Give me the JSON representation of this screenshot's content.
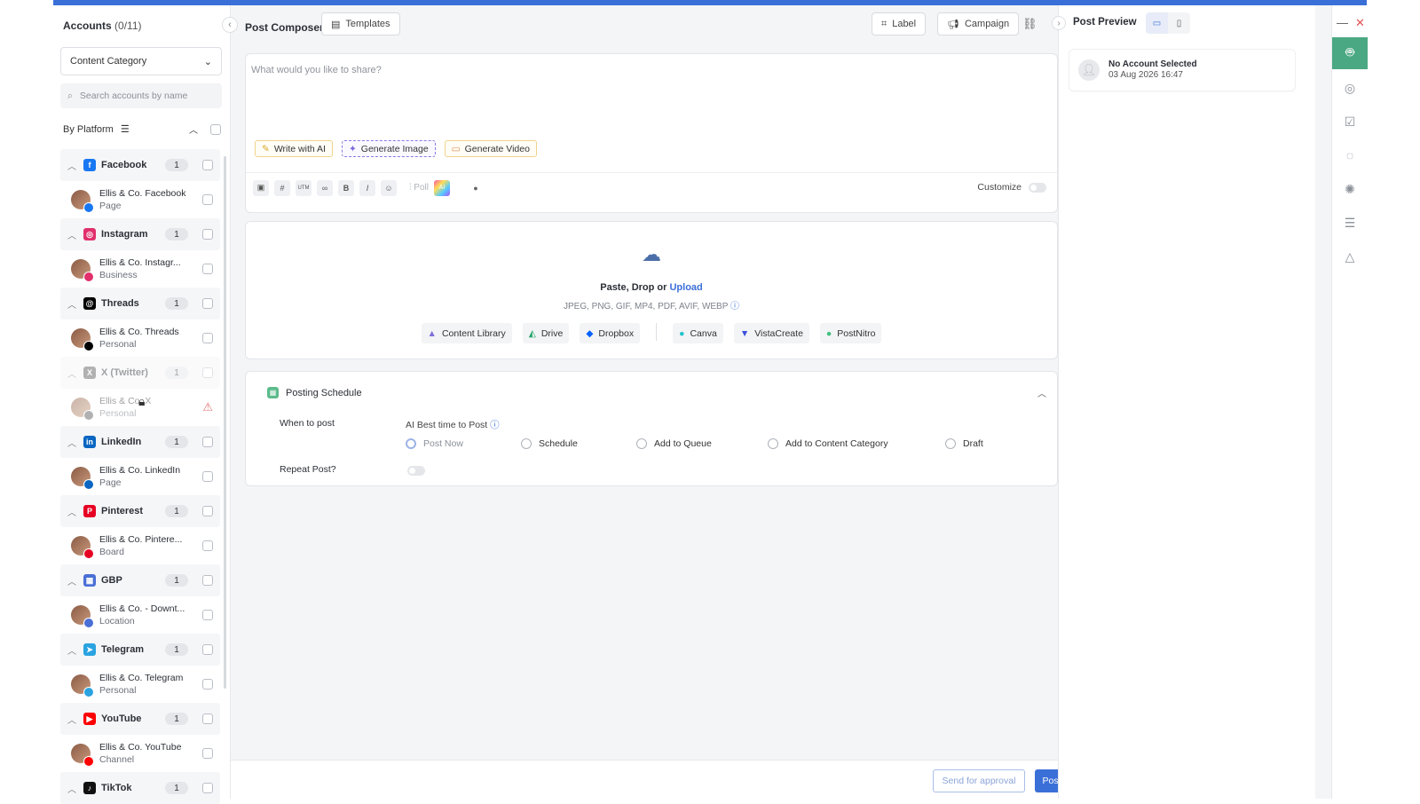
{
  "accounts_panel": {
    "title": "Accounts",
    "count": "(0/11)",
    "category_select": "Content Category",
    "search_placeholder": "Search accounts by name",
    "by_platform": "By Platform",
    "groups": [
      {
        "name": "Facebook",
        "count": "1",
        "color": "#1877f2",
        "icon": "facebook-icon",
        "glyph": "f",
        "account": "Ellis & Co. Facebook",
        "type": "Page"
      },
      {
        "name": "Instagram",
        "count": "1",
        "color": "#e1306c",
        "icon": "instagram-icon",
        "glyph": "◎",
        "account": "Ellis & Co. Instagr...",
        "type": "Business"
      },
      {
        "name": "Threads",
        "count": "1",
        "color": "#000000",
        "icon": "threads-icon",
        "glyph": "@",
        "account": "Ellis & Co. Threads",
        "type": "Personal"
      },
      {
        "name": "X (Twitter)",
        "count": "1",
        "color": "#555555",
        "icon": "x-twitter-icon",
        "glyph": "X",
        "account": "Ellis & Co. X",
        "type": "Personal",
        "disabled": true
      },
      {
        "name": "LinkedIn",
        "count": "1",
        "color": "#0a66c2",
        "icon": "linkedin-icon",
        "glyph": "in",
        "account": "Ellis & Co. LinkedIn",
        "type": "Page"
      },
      {
        "name": "Pinterest",
        "count": "1",
        "color": "#e60023",
        "icon": "pinterest-icon",
        "glyph": "P",
        "account": "Ellis & Co. Pintere...",
        "type": "Board"
      },
      {
        "name": "GBP",
        "count": "1",
        "color": "#4a6fd6",
        "icon": "gbp-icon",
        "glyph": "▦",
        "account": "Ellis & Co. - Downt...",
        "type": "Location"
      },
      {
        "name": "Telegram",
        "count": "1",
        "color": "#2aa3e0",
        "icon": "telegram-icon",
        "glyph": "➤",
        "account": "Ellis & Co. Telegram",
        "type": "Personal"
      },
      {
        "name": "YouTube",
        "count": "1",
        "color": "#ff0000",
        "icon": "youtube-icon",
        "glyph": "▶",
        "account": "Ellis & Co. YouTube",
        "type": "Channel"
      },
      {
        "name": "TikTok",
        "count": "1",
        "color": "#111111",
        "icon": "tiktok-icon",
        "glyph": "♪"
      }
    ]
  },
  "composer": {
    "title": "Post Composer",
    "templates": "Templates",
    "label": "Label",
    "campaign": "Campaign",
    "placeholder": "What would you like to share?",
    "ai_buttons": [
      "Write with AI",
      "Generate Image",
      "Generate Video"
    ],
    "toolbar_poll": "Poll",
    "customize": "Customize"
  },
  "upload": {
    "text_prefix": "Paste, Drop or",
    "link": "Upload",
    "formats": "JPEG, PNG, GIF, MP4, PDF, AVIF, WEBP",
    "sources": [
      "Content Library",
      "Drive",
      "Dropbox"
    ],
    "integrations": [
      "Canva",
      "VistaCreate",
      "PostNitro"
    ]
  },
  "schedule": {
    "title": "Posting Schedule",
    "when_label": "When to post",
    "ai_best": "AI Best time to Post",
    "options": [
      "Post Now",
      "Schedule",
      "Add to Queue",
      "Add to Content Category",
      "Draft"
    ],
    "selected": "Post Now",
    "repeat_label": "Repeat Post?"
  },
  "footer": {
    "approval": "Send for approval",
    "post_now": "Post Now"
  },
  "preview": {
    "title": "Post Preview",
    "account": "No Account Selected",
    "date": "03 Aug 2026 16:47"
  },
  "colors": {
    "accent": "#3b6fd8",
    "bot": "#4aa883"
  }
}
